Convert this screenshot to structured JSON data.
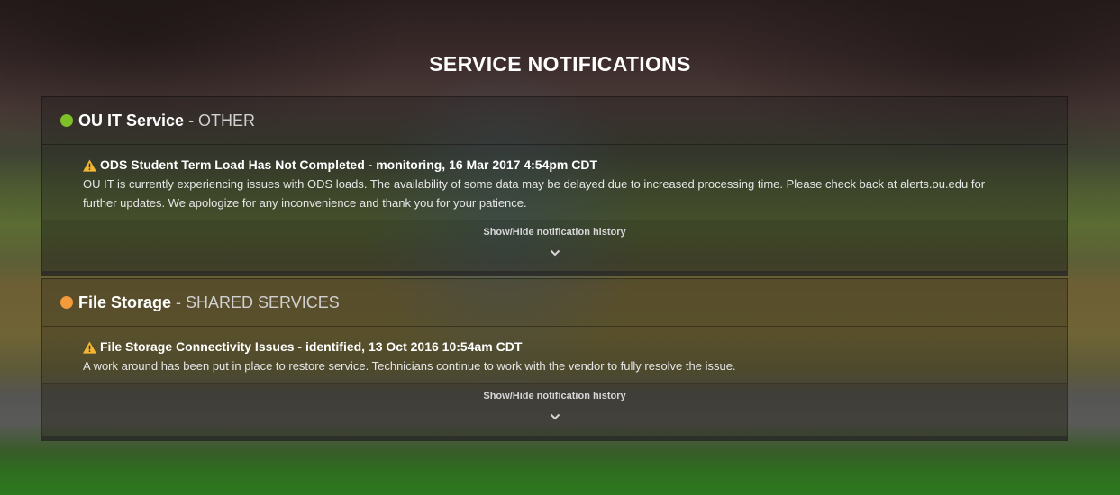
{
  "page": {
    "title": "SERVICE NOTIFICATIONS"
  },
  "notifications": [
    {
      "service": "OU IT Service",
      "category": "- OTHER",
      "status_color": "#7dc02a",
      "notice_title": "ODS Student Term Load Has Not Completed - monitoring, 16 Mar 2017 4:54pm CDT",
      "notice_text": "OU IT is currently experiencing issues with ODS loads. The availability of some data may be delayed due to increased processing time. Please check back at alerts.ou.edu for further updates. We apologize for any inconvenience and thank you for your patience.",
      "history_label": "Show/Hide notification history"
    },
    {
      "service": "File Storage",
      "category": "- SHARED SERVICES",
      "status_color": "#f39a3c",
      "notice_title": "File Storage Connectivity Issues - identified, 13 Oct 2016 10:54am CDT",
      "notice_text": "A work around has been put in place to restore service. Technicians continue to work with the vendor to fully resolve the issue.",
      "history_label": "Show/Hide notification history"
    }
  ],
  "icons": {
    "status": "status-dot-icon",
    "warning": "warning-icon",
    "expand": "chevron-down-icon"
  },
  "colors": {
    "warning": "#f5b731"
  }
}
